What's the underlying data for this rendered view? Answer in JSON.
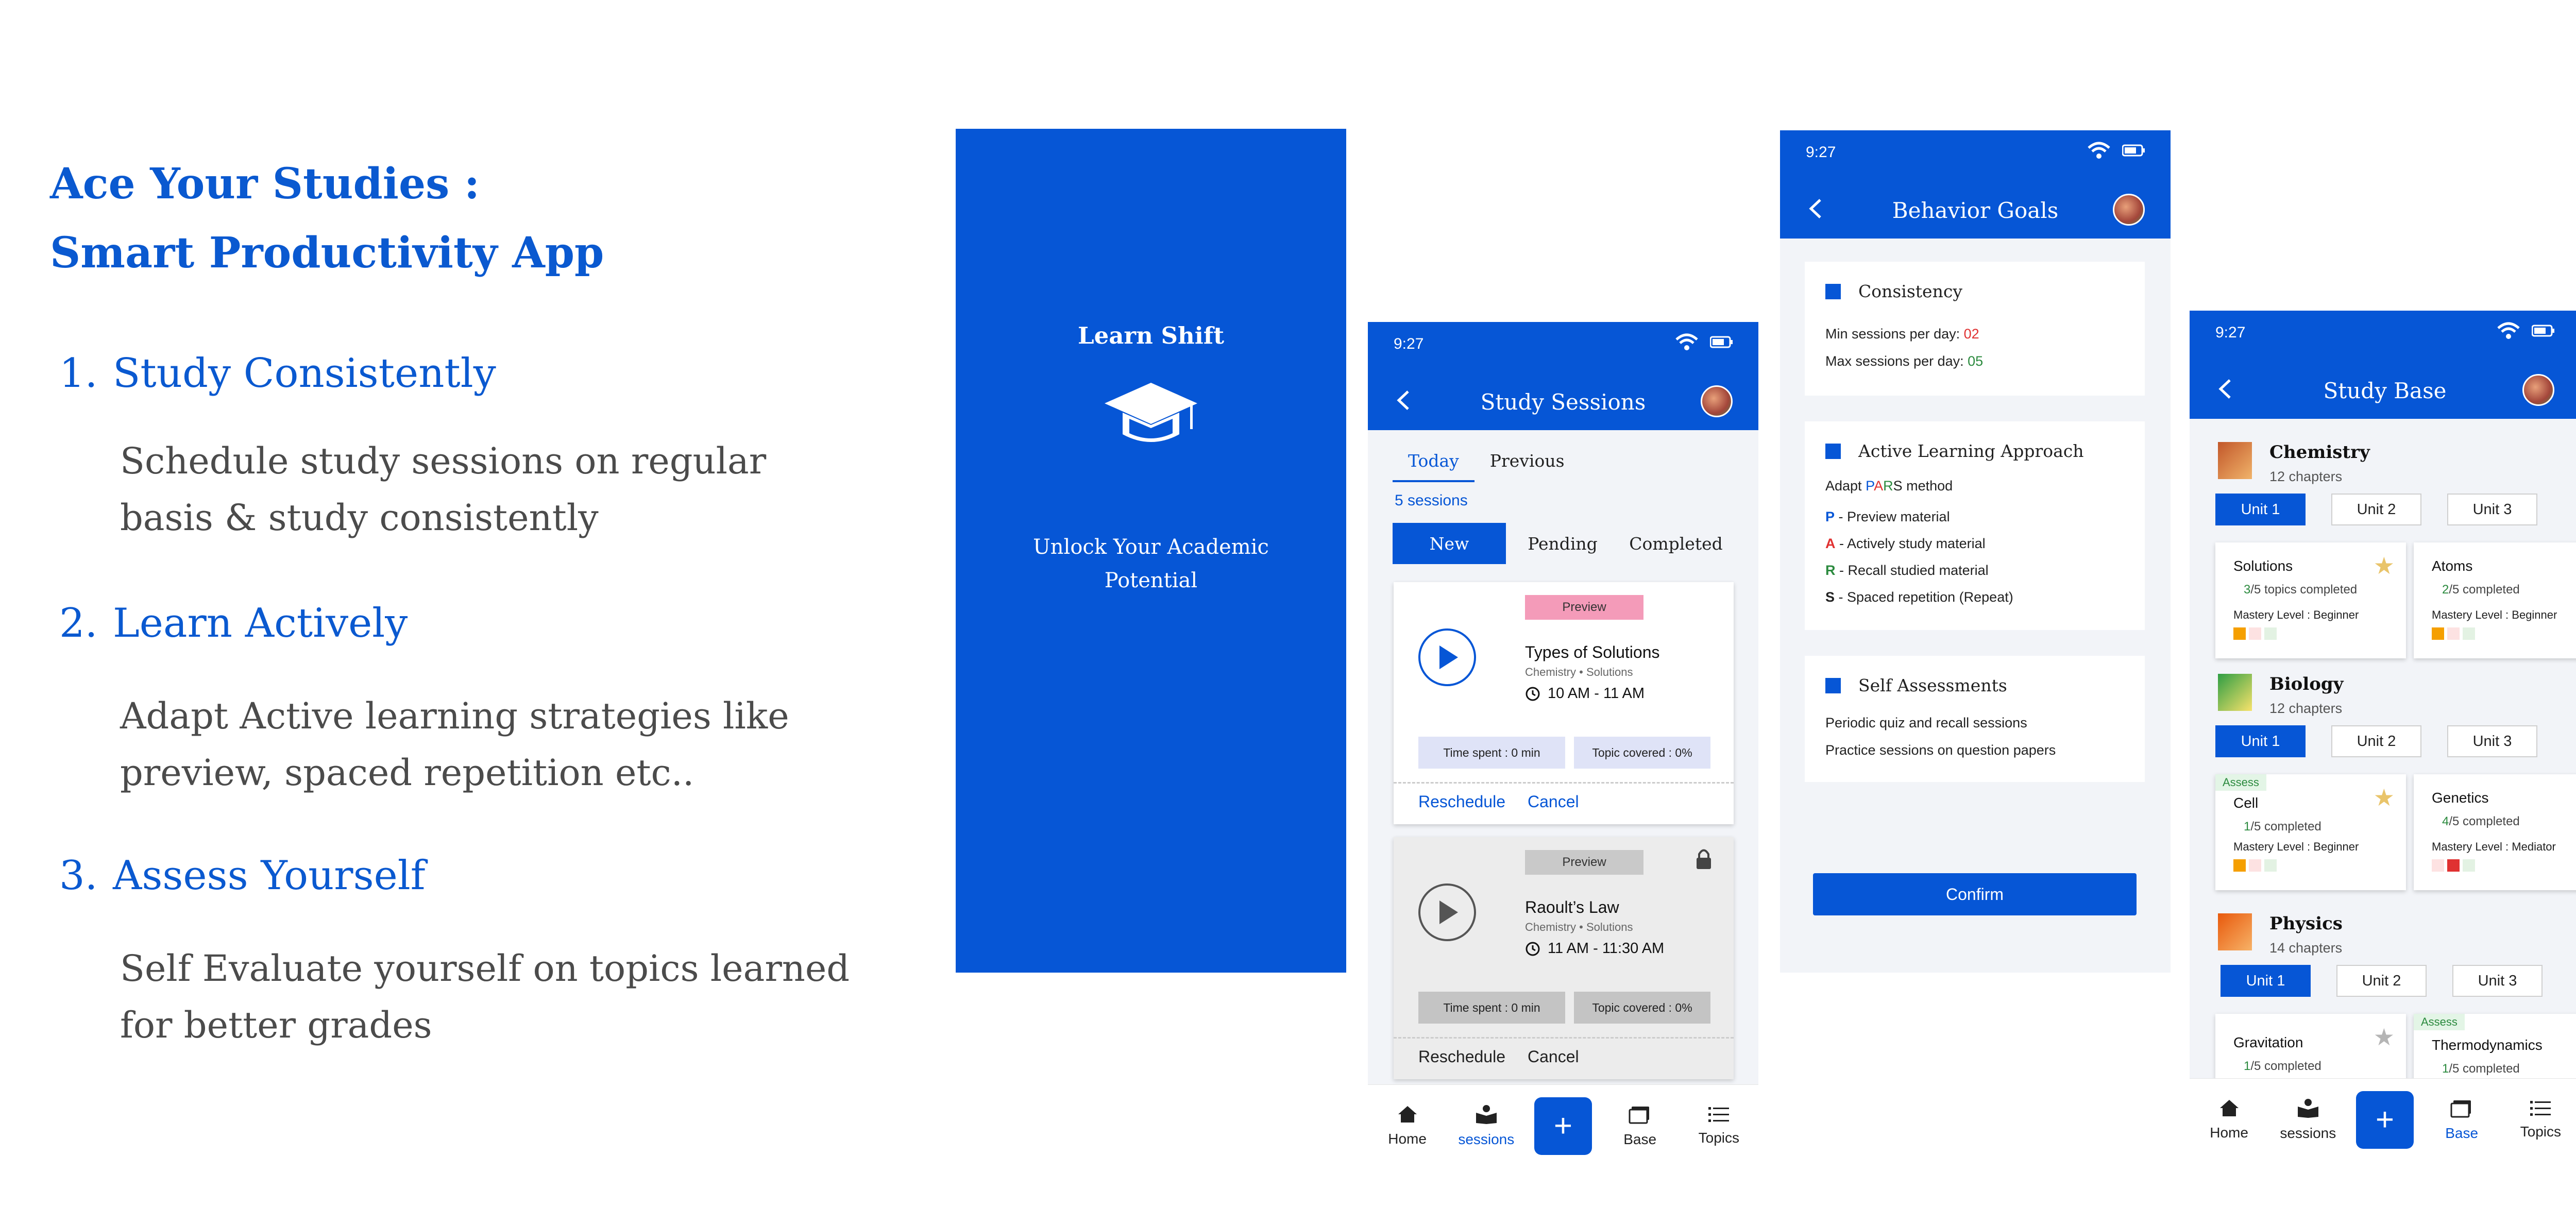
{
  "hero": {
    "line1": "Ace Your Studies :",
    "line2": "Smart Productivity App"
  },
  "features": [
    {
      "num": "1.",
      "title": "Study Consistently",
      "line1": "Schedule study sessions on regular",
      "line2": "basis & study consistently"
    },
    {
      "num": "2.",
      "title": "Learn Actively",
      "line1": "Adapt Active learning strategies like",
      "line2": "preview, spaced repetition etc.."
    },
    {
      "num": "3.",
      "title": "Assess Yourself",
      "line1": "Self Evaluate yourself on topics learned",
      "line2": "for better grades"
    }
  ],
  "splash": {
    "brand": "Learn Shift",
    "tagline1": "Unlock Your Academic",
    "tagline2": "Potential",
    "bg_color": "#0656d6"
  },
  "status": {
    "time": "9:27"
  },
  "sessions": {
    "title": "Study Sessions",
    "tabs": [
      "Today",
      "Previous"
    ],
    "count": "5 sessions",
    "filters": [
      "New",
      "Pending",
      "Completed"
    ],
    "cards": [
      {
        "chip": "Preview",
        "title": "Types of Solutions",
        "sub": "Chemistry • Solutions",
        "time": "10 AM - 11 AM",
        "spent": "Time spent  : 0 min",
        "covered": "Topic covered : 0%",
        "reschedule": "Reschedule",
        "cancel": "Cancel",
        "chip_color": "#f49bb9"
      },
      {
        "chip": "Preview",
        "title": "Raoult’s Law",
        "sub": "Chemistry • Solutions",
        "time": "11 AM - 11:30 AM",
        "spent": "Time spent  : 0 min",
        "covered": "Topic covered : 0%",
        "reschedule": "Reschedule",
        "cancel": "Cancel",
        "chip_color": "#c9c9c9"
      }
    ]
  },
  "goals": {
    "title": "Behavior Goals",
    "consistency": {
      "title": "Consistency",
      "min_label": "Min sessions per day: ",
      "min_val": "02",
      "max_label": "Max sessions per day: ",
      "max_val": "05"
    },
    "active": {
      "title": "Active Learning Approach",
      "adapt_pre": "Adapt ",
      "pars": [
        "P",
        "A",
        "R",
        "S"
      ],
      "adapt_post": " method",
      "items": [
        {
          "letter": "P",
          "text": " - Preview material"
        },
        {
          "letter": "A",
          "text": " - Actively study material"
        },
        {
          "letter": "R",
          "text": " - Recall studied material"
        },
        {
          "letter": "S",
          "text": " - Spaced repetition (Repeat)"
        }
      ]
    },
    "self": {
      "title": "Self Assessments",
      "line1": "Periodic quiz and recall sessions",
      "line2": "Practice sessions on question papers"
    },
    "confirm": "Confirm"
  },
  "base": {
    "title": "Study Base",
    "subjects": [
      {
        "name": "Chemistry",
        "chapters": "12 chapters",
        "units": [
          "Unit 1",
          "Unit 2",
          "Unit 3"
        ],
        "topics": [
          {
            "name": "Solutions",
            "done": "3",
            "total": "/5",
            "progress_text": "topics completed",
            "mastery": "Mastery Level : Beginner",
            "starred": true,
            "assess": ""
          },
          {
            "name": "Atoms",
            "done": "2",
            "total": "/5",
            "progress_text": "completed",
            "mastery": "Mastery Level : Beginner",
            "starred": true,
            "assess": ""
          }
        ]
      },
      {
        "name": "Biology",
        "chapters": "12 chapters",
        "units": [
          "Unit 1",
          "Unit 2",
          "Unit 3"
        ],
        "topics": [
          {
            "name": "Cell",
            "done": "1",
            "total": "/5",
            "progress_text": "completed",
            "mastery": "Mastery Level : Beginner",
            "starred": true,
            "assess": "Assess"
          },
          {
            "name": "Genetics",
            "done": "4",
            "total": "/5",
            "progress_text": "completed",
            "mastery": "Mastery Level : Mediator",
            "starred": false,
            "assess": ""
          }
        ]
      },
      {
        "name": "Physics",
        "chapters": "14 chapters",
        "units": [
          "Unit 1",
          "Unit 2",
          "Unit 3"
        ],
        "topics": [
          {
            "name": "Gravitation",
            "done": "1",
            "total": "/5",
            "progress_text": "completed",
            "mastery": "",
            "starred": false,
            "assess": ""
          },
          {
            "name": "Thermodynamics",
            "done": "1",
            "total": "/5",
            "progress_text": "completed",
            "mastery": "",
            "starred": false,
            "assess": "Assess"
          }
        ]
      }
    ]
  },
  "nav": {
    "home": "Home",
    "sessions": "sessions",
    "plus": "+",
    "base": "Base",
    "topics": "Topics"
  },
  "colors": {
    "primary": "#0656d6",
    "min_val": "#e03131",
    "max_val": "#2b8a3e",
    "star_on": "#e9c46a",
    "star_off": "#b5b5b5"
  }
}
